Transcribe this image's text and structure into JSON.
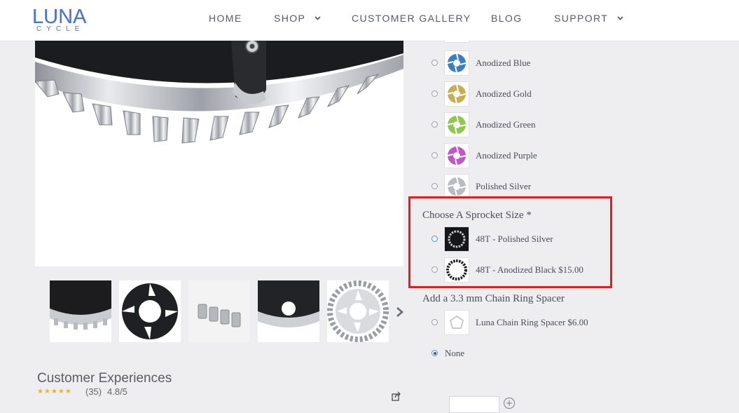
{
  "logo": {
    "main": "LUNA",
    "sub": "CYCLE"
  },
  "nav": {
    "home": "HOME",
    "shop": "SHOP",
    "gallery": "CUSTOMER GALLERY",
    "blog": "BLOG",
    "support": "SUPPORT"
  },
  "icons": {
    "shop_chevron": "chevron-down-icon",
    "support_chevron": "chevron-down-icon",
    "thumb_next": "chevron-right-icon",
    "share": "share-icon",
    "plus": "plus-circle-icon"
  },
  "colors": {
    "brand": "#4a76d2",
    "highlight": "#dd1f26",
    "star": "#f2b01e",
    "anodized_blue": "#3a7fc0",
    "anodized_gold": "#c9ad55",
    "anodized_green": "#8fc94a",
    "anodized_purple": "#c455c8",
    "polished_silver": "#b8bcc2"
  },
  "color_options": [
    {
      "label": "Anodized Blue"
    },
    {
      "label": "Anodized Gold"
    },
    {
      "label": "Anodized Green"
    },
    {
      "label": "Anodized Purple"
    },
    {
      "label": "Polished Silver"
    }
  ],
  "sprocket": {
    "title": "Choose A Sprocket Size *",
    "options": [
      {
        "label": "48T - Polished Silver",
        "selected": true
      },
      {
        "label": "48T - Anodized Black $15.00",
        "selected": false
      }
    ]
  },
  "spacer": {
    "title": "Add a 3.3 mm Chain Ring Spacer",
    "options": [
      {
        "label": "Luna Chain Ring Spacer $6.00",
        "selected": false
      },
      {
        "label": "None",
        "selected": true
      }
    ]
  },
  "reviews": {
    "title": "Customer Experiences",
    "stars": "★★★★★",
    "count": "(35)",
    "rating": "4.8/5"
  }
}
